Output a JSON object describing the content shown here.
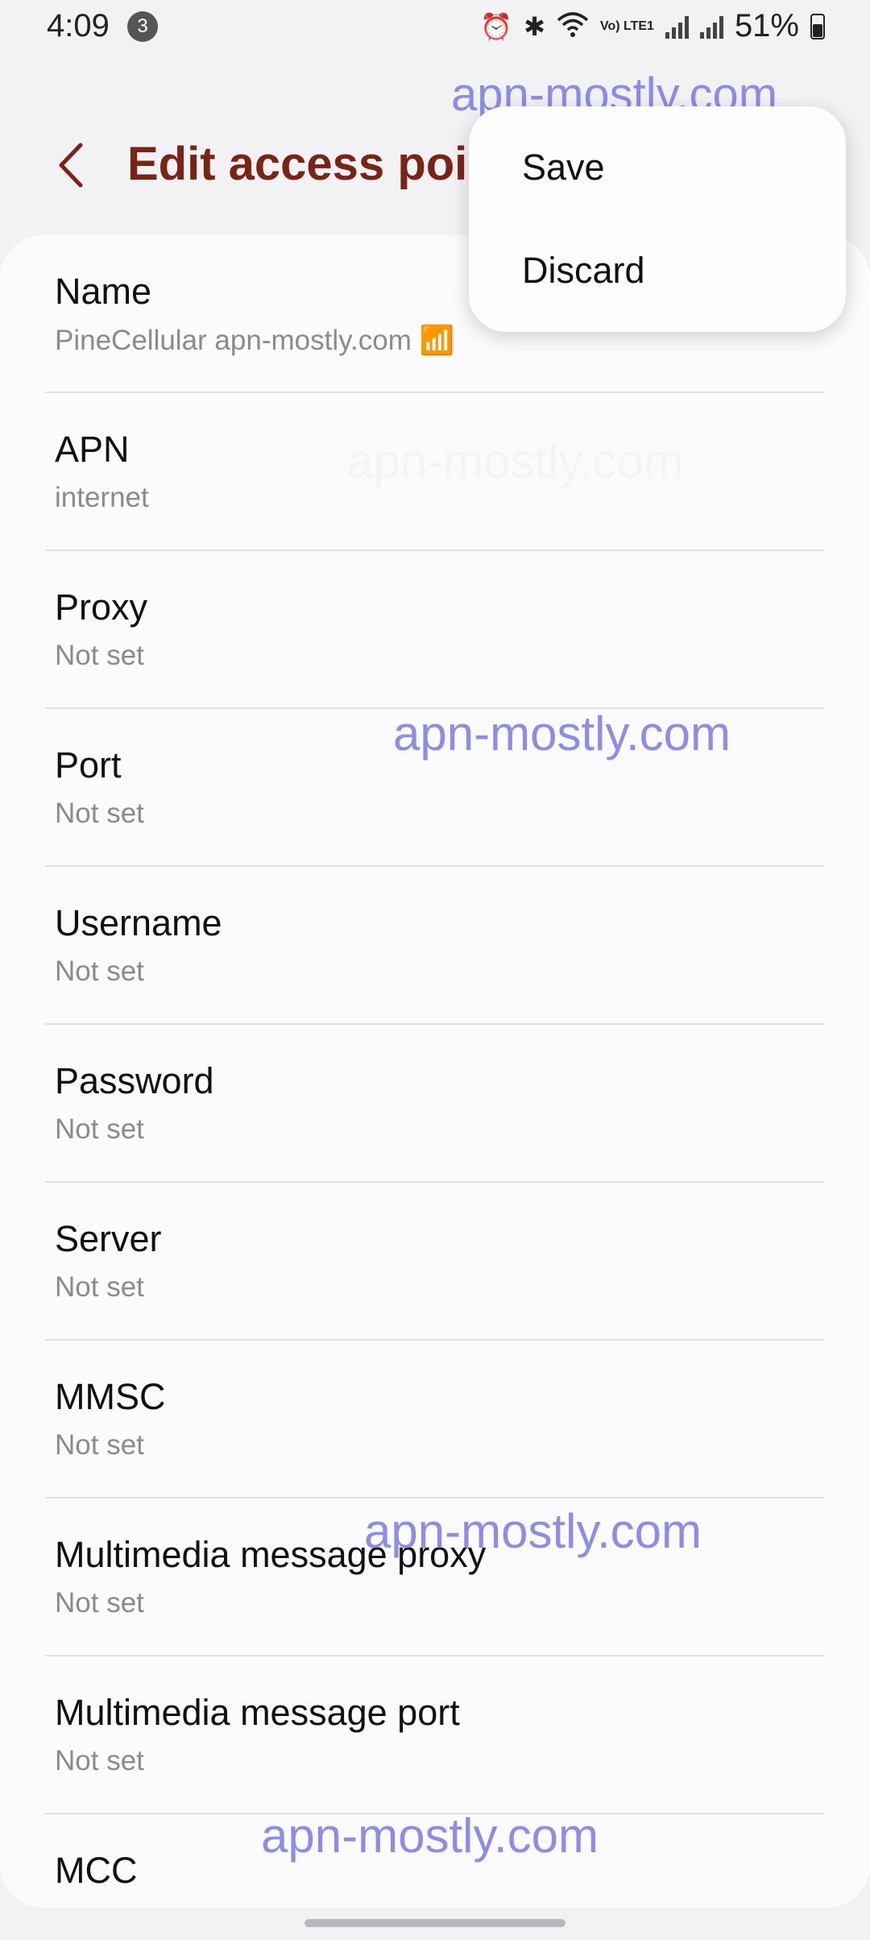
{
  "status_bar": {
    "time": "4:09",
    "notification_count": "3",
    "battery": "51%",
    "volte_label": "Vo) LTE1",
    "icons": [
      "alarm-icon",
      "bluetooth-icon",
      "wifi-icon",
      "volte-icon",
      "signal-icon",
      "signal-icon",
      "battery-icon"
    ]
  },
  "app_bar": {
    "title": "Edit access poir"
  },
  "menu": {
    "items": [
      {
        "label": "Save"
      },
      {
        "label": "Discard"
      }
    ]
  },
  "fields": [
    {
      "label": "Name",
      "value": "PineCellular apn-mostly.com 📶"
    },
    {
      "label": "APN",
      "value": "internet"
    },
    {
      "label": "Proxy",
      "value": "Not set"
    },
    {
      "label": "Port",
      "value": "Not set"
    },
    {
      "label": "Username",
      "value": "Not set"
    },
    {
      "label": "Password",
      "value": "Not set"
    },
    {
      "label": "Server",
      "value": "Not set"
    },
    {
      "label": "MMSC",
      "value": "Not set"
    },
    {
      "label": "Multimedia message proxy",
      "value": "Not set"
    },
    {
      "label": "Multimedia message port",
      "value": "Not set"
    },
    {
      "label": "MCC",
      "value": ""
    }
  ],
  "watermarks": [
    "apn-mostly.com",
    "apn-mostly.com",
    "apn-mostly.com",
    "apn-mostly.com",
    "apn-mostly.com"
  ],
  "colors": {
    "title": "#7a2418",
    "background": "#f2f2f5",
    "card": "#fbfbfd",
    "watermark": "#7f82e6",
    "secondary_text": "#8b8b8b"
  }
}
